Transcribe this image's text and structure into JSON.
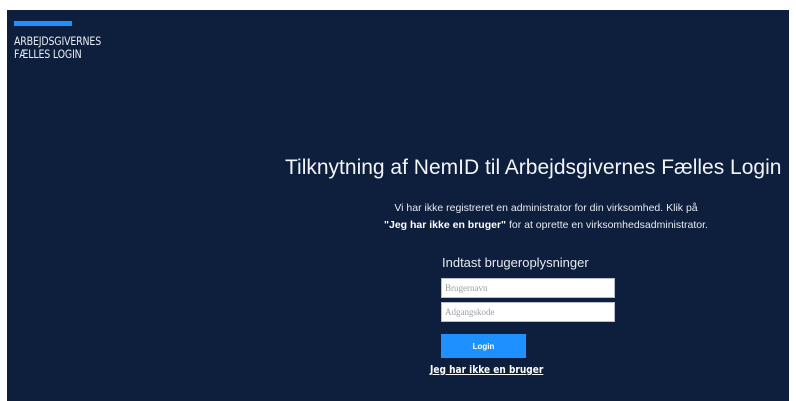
{
  "brand": {
    "line1": "ARBEJDSGIVERNES",
    "line2": "FÆLLES LOGIN",
    "accent_color": "#1e90ff"
  },
  "page": {
    "background_color": "#0d1f3c",
    "title": "Tilknytning af NemID til Arbejdsgivernes Fælles Login",
    "intro_line1": "Vi har ikke registreret en administrator for din virksomhed. Klik på",
    "intro_bold": "\"Jeg har ikke en bruger\"",
    "intro_line2_rest": " for at oprette en virksomhedsadministrator.",
    "subheading": "Indtast brugeroplysninger"
  },
  "form": {
    "username": {
      "placeholder": "Brugernavn",
      "value": ""
    },
    "password": {
      "placeholder": "Adgangskode",
      "value": ""
    },
    "login_label": "Login",
    "no_user_link": "Jeg har ikke en bruger"
  }
}
